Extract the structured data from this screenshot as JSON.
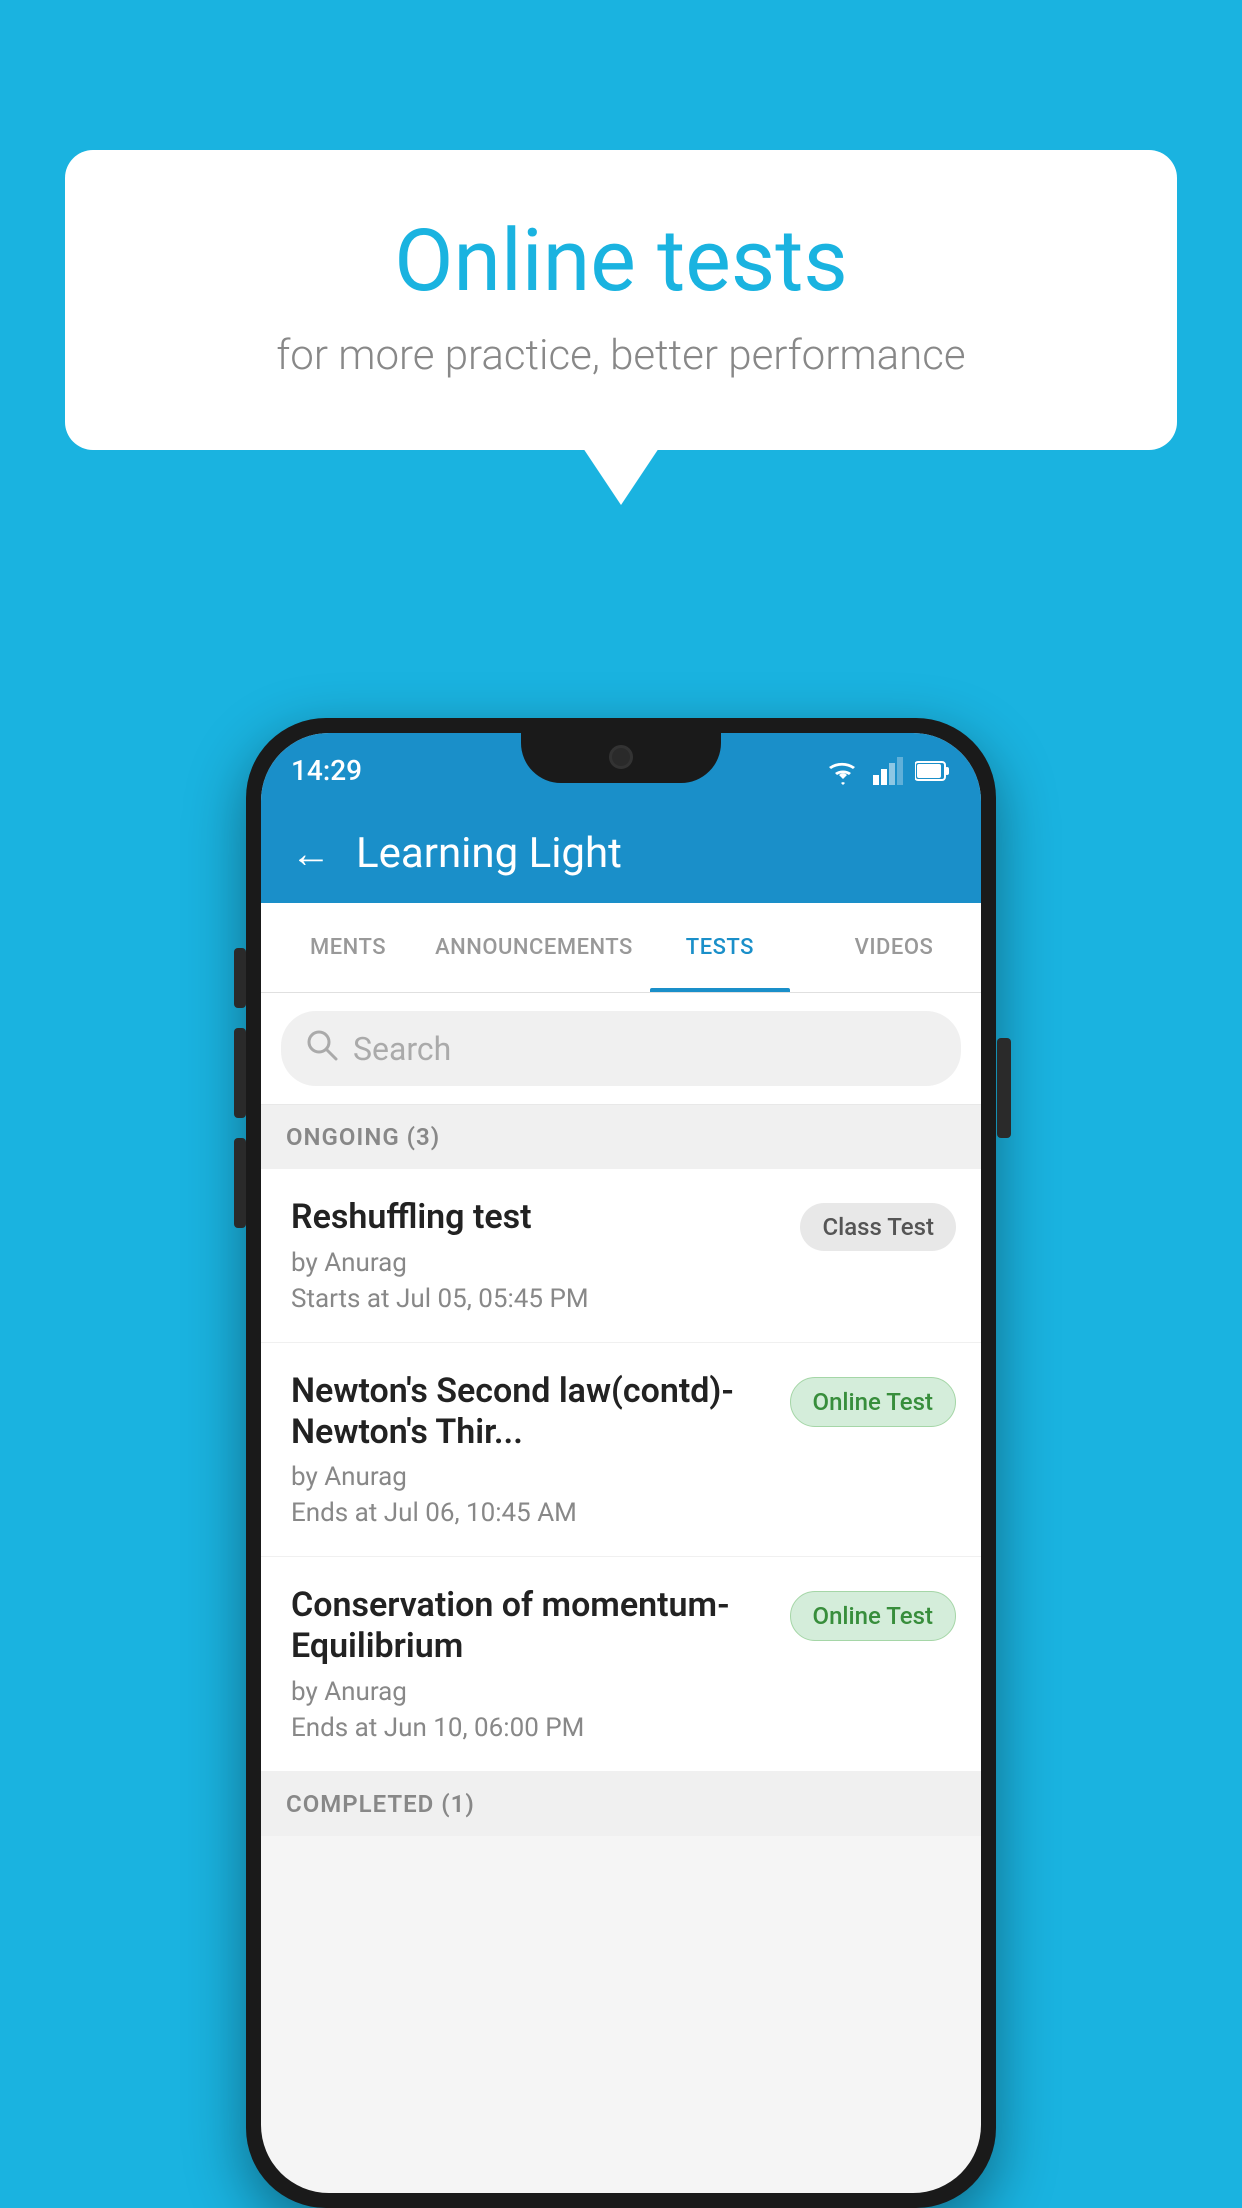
{
  "background_color": "#1ab3e0",
  "bubble": {
    "title": "Online tests",
    "subtitle": "for more practice, better performance"
  },
  "phone": {
    "status_bar": {
      "time": "14:29",
      "signal_icons": "▼◀▉"
    },
    "header": {
      "back_label": "←",
      "title": "Learning Light"
    },
    "tabs": [
      {
        "label": "MENTS",
        "active": false
      },
      {
        "label": "ANNOUNCEMENTS",
        "active": false
      },
      {
        "label": "TESTS",
        "active": true
      },
      {
        "label": "VIDEOS",
        "active": false
      }
    ],
    "search": {
      "placeholder": "Search"
    },
    "ongoing_section": {
      "label": "ONGOING (3)"
    },
    "tests": [
      {
        "name": "Reshuffling test",
        "by": "by Anurag",
        "time_label": "Starts at",
        "time_value": "Jul 05, 05:45 PM",
        "badge": "Class Test",
        "badge_type": "class"
      },
      {
        "name": "Newton's Second law(contd)-Newton's Thir...",
        "by": "by Anurag",
        "time_label": "Ends at",
        "time_value": "Jul 06, 10:45 AM",
        "badge": "Online Test",
        "badge_type": "online"
      },
      {
        "name": "Conservation of momentum-Equilibrium",
        "by": "by Anurag",
        "time_label": "Ends at",
        "time_value": "Jun 10, 06:00 PM",
        "badge": "Online Test",
        "badge_type": "online"
      }
    ],
    "completed_section": {
      "label": "COMPLETED (1)"
    }
  }
}
